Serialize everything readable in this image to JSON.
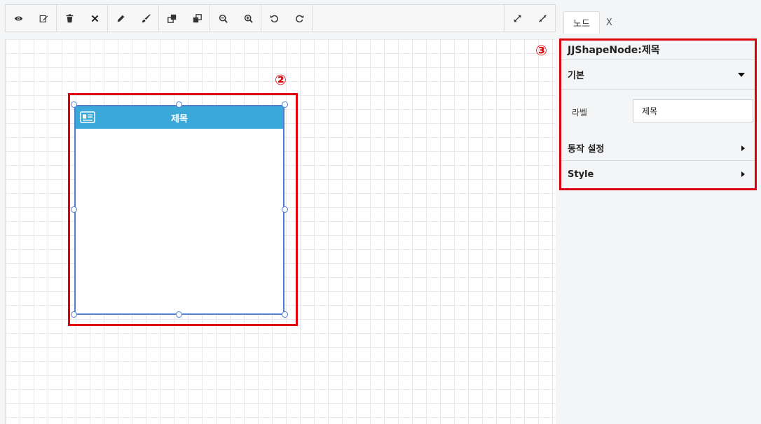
{
  "toolbar": {
    "left_groups": [
      [
        "eye-icon",
        "edit-icon"
      ],
      [
        "trash-icon",
        "close-icon"
      ],
      [
        "pencil-icon",
        "brush-icon"
      ],
      [
        "bring-forward-icon",
        "send-backward-icon"
      ],
      [
        "zoom-out-icon",
        "zoom-in-icon"
      ],
      [
        "undo-icon",
        "redo-icon"
      ]
    ],
    "right_group": [
      "expand-icon",
      "collapse-icon"
    ]
  },
  "canvas": {
    "marker": "②",
    "node": {
      "title": "제목",
      "icon": "card-icon",
      "header_color": "#3aa9da",
      "border_color": "#4f7fd1"
    }
  },
  "panel": {
    "marker": "③",
    "tabs": [
      {
        "label": "노드",
        "active": true
      },
      {
        "label": "X",
        "active": false
      }
    ],
    "title": "JJShapeNode:제목",
    "sections": {
      "basic": {
        "label": "기본",
        "expanded": true
      },
      "action": {
        "label": "동작 설정",
        "expanded": false
      },
      "style": {
        "label": "Style",
        "expanded": false
      }
    },
    "label_field": {
      "label": "라벨",
      "value": "제목"
    }
  },
  "colors": {
    "highlight": "#e0000b",
    "panel_bg": "#f4f5f7"
  }
}
